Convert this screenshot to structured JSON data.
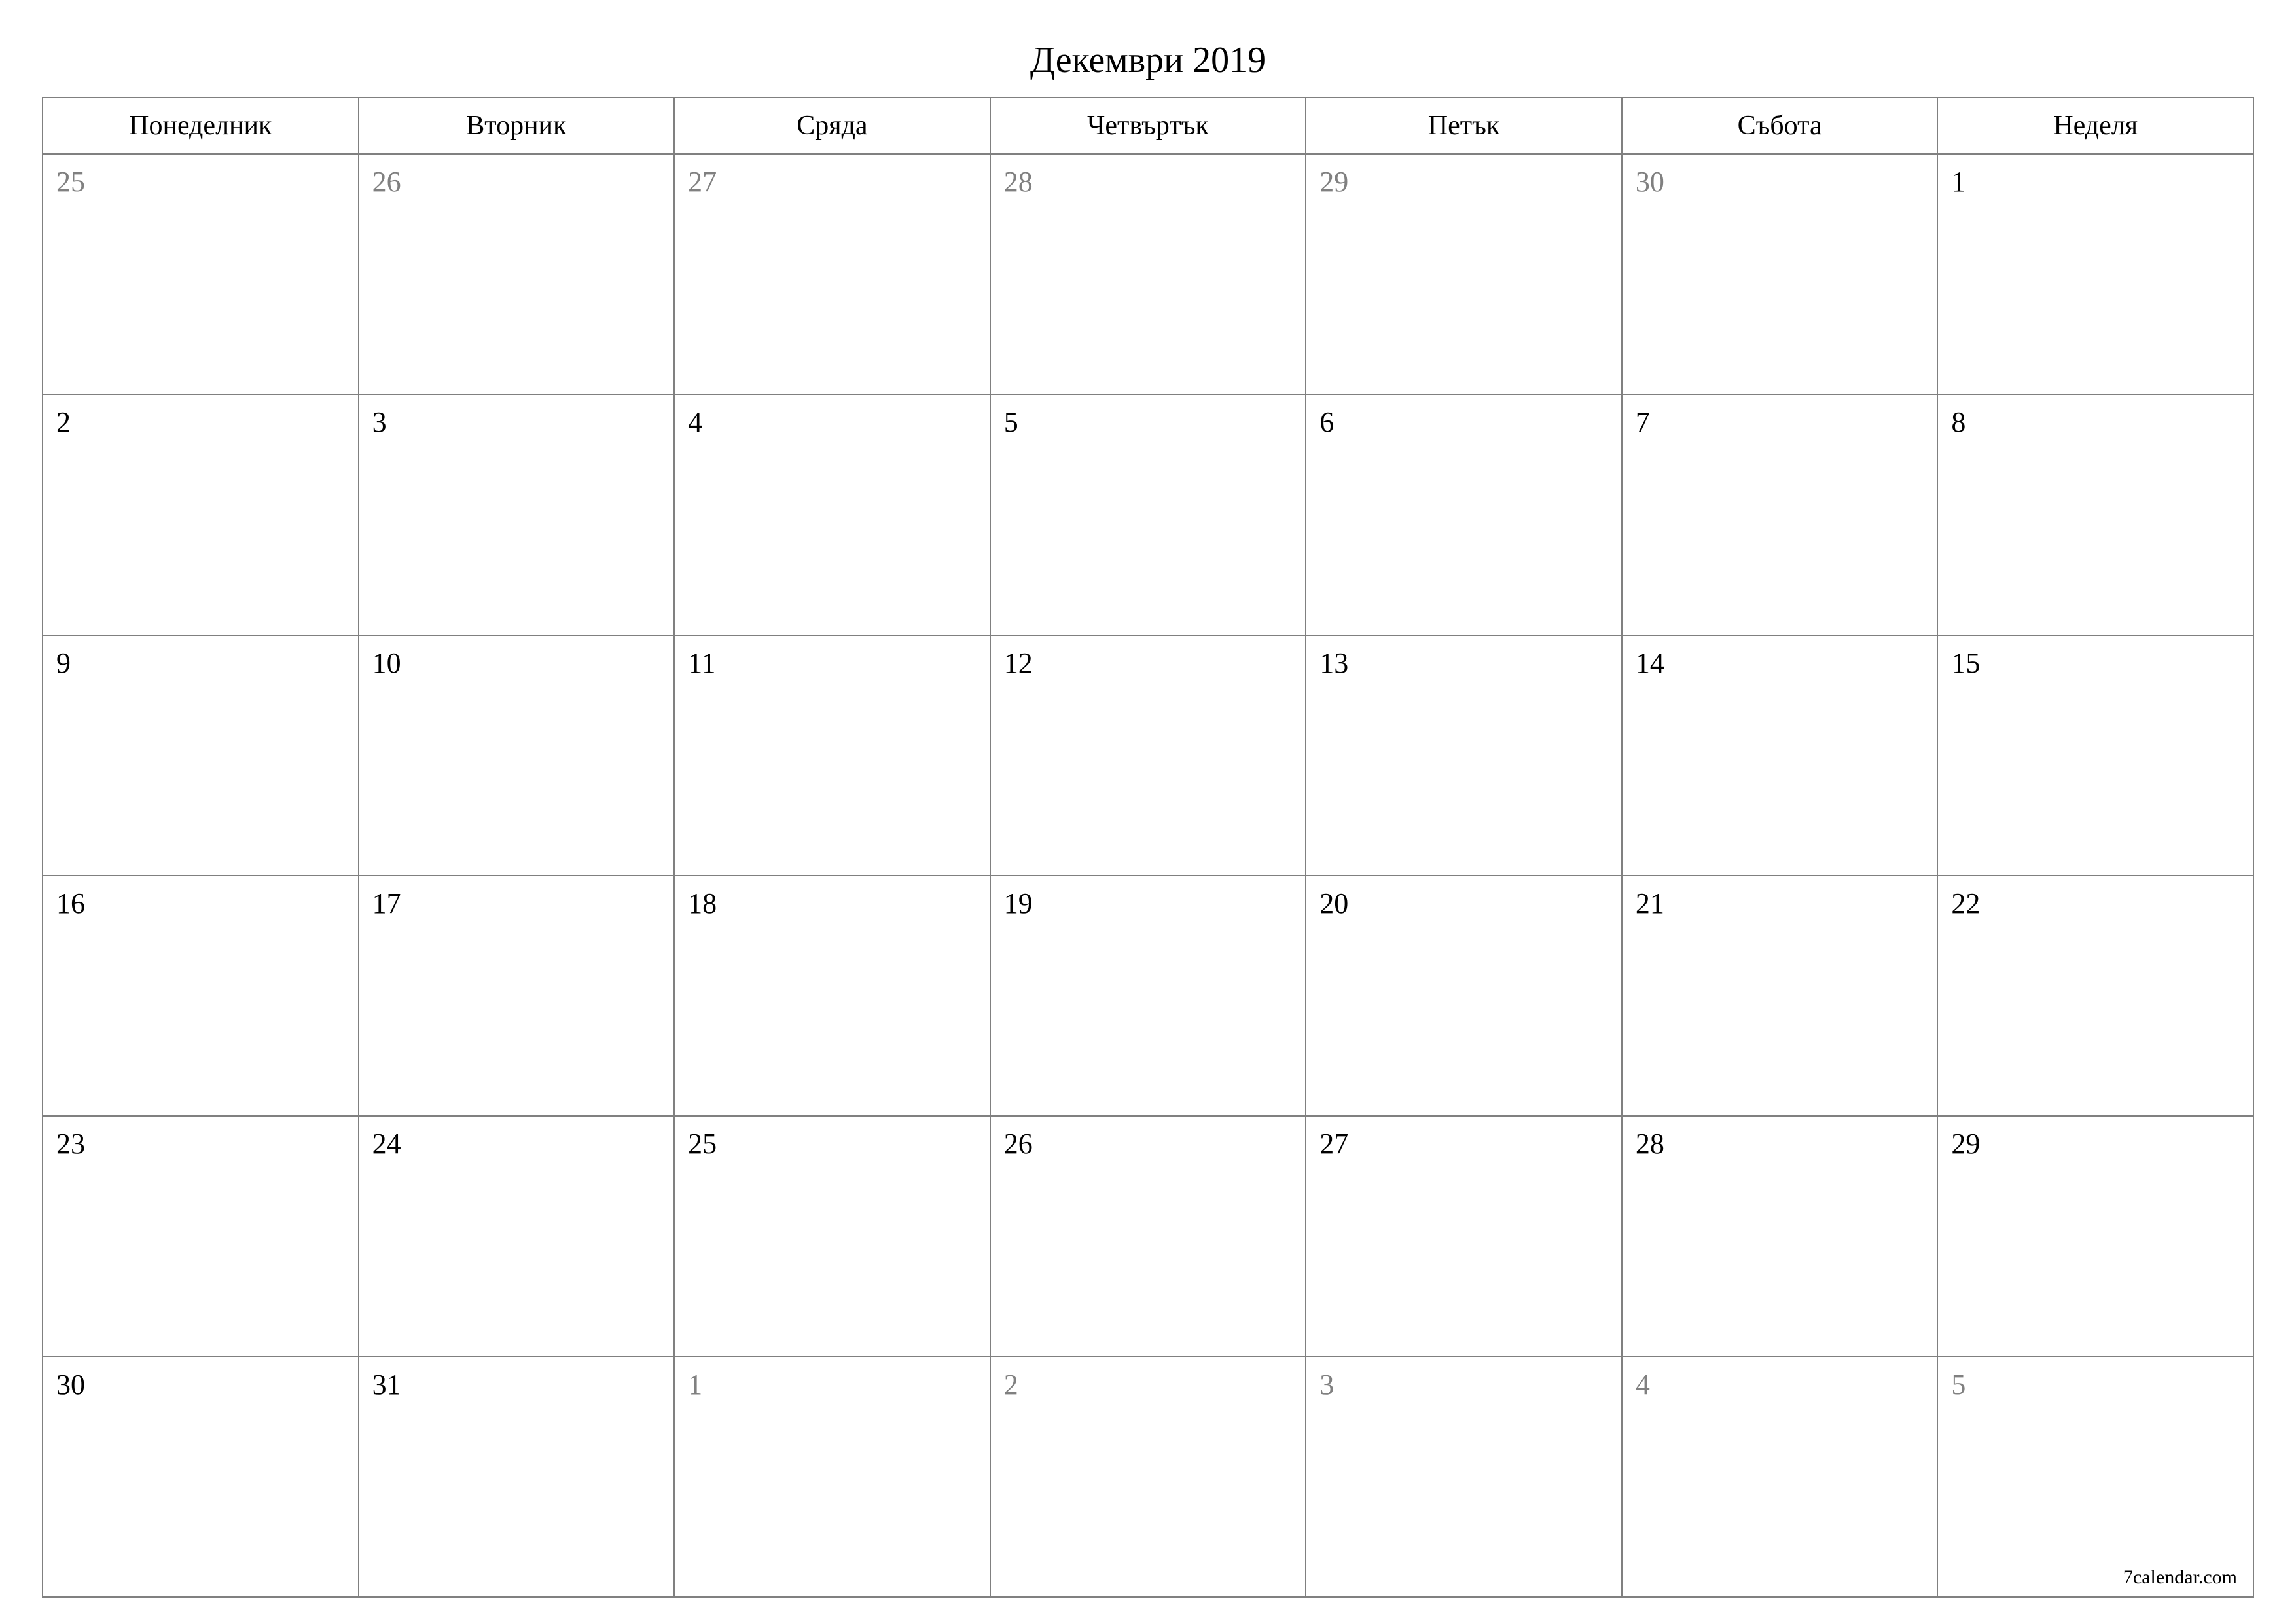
{
  "title": "Декември 2019",
  "weekdays": [
    "Понеделник",
    "Вторник",
    "Сряда",
    "Четвъртък",
    "Петък",
    "Събота",
    "Неделя"
  ],
  "weeks": [
    [
      {
        "d": "25",
        "other": true
      },
      {
        "d": "26",
        "other": true
      },
      {
        "d": "27",
        "other": true
      },
      {
        "d": "28",
        "other": true
      },
      {
        "d": "29",
        "other": true
      },
      {
        "d": "30",
        "other": true
      },
      {
        "d": "1",
        "other": false
      }
    ],
    [
      {
        "d": "2",
        "other": false
      },
      {
        "d": "3",
        "other": false
      },
      {
        "d": "4",
        "other": false
      },
      {
        "d": "5",
        "other": false
      },
      {
        "d": "6",
        "other": false
      },
      {
        "d": "7",
        "other": false
      },
      {
        "d": "8",
        "other": false
      }
    ],
    [
      {
        "d": "9",
        "other": false
      },
      {
        "d": "10",
        "other": false
      },
      {
        "d": "11",
        "other": false
      },
      {
        "d": "12",
        "other": false
      },
      {
        "d": "13",
        "other": false
      },
      {
        "d": "14",
        "other": false
      },
      {
        "d": "15",
        "other": false
      }
    ],
    [
      {
        "d": "16",
        "other": false
      },
      {
        "d": "17",
        "other": false
      },
      {
        "d": "18",
        "other": false
      },
      {
        "d": "19",
        "other": false
      },
      {
        "d": "20",
        "other": false
      },
      {
        "d": "21",
        "other": false
      },
      {
        "d": "22",
        "other": false
      }
    ],
    [
      {
        "d": "23",
        "other": false
      },
      {
        "d": "24",
        "other": false
      },
      {
        "d": "25",
        "other": false
      },
      {
        "d": "26",
        "other": false
      },
      {
        "d": "27",
        "other": false
      },
      {
        "d": "28",
        "other": false
      },
      {
        "d": "29",
        "other": false
      }
    ],
    [
      {
        "d": "30",
        "other": false
      },
      {
        "d": "31",
        "other": false
      },
      {
        "d": "1",
        "other": true
      },
      {
        "d": "2",
        "other": true
      },
      {
        "d": "3",
        "other": true
      },
      {
        "d": "4",
        "other": true
      },
      {
        "d": "5",
        "other": true
      }
    ]
  ],
  "footer": "7calendar.com"
}
